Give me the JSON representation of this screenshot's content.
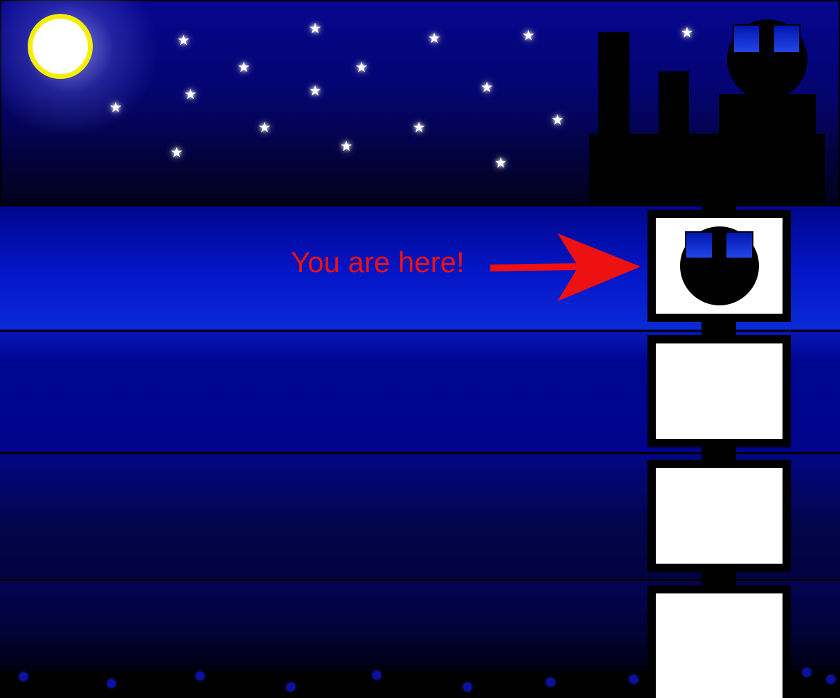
{
  "scene": {
    "caption": "You are here!",
    "caption_color": "#ee1111",
    "moon_color": "#ffffff",
    "moon_ring_color": "#f2ef00",
    "star_glyph": "★",
    "floors": 4,
    "current_floor": 1
  }
}
